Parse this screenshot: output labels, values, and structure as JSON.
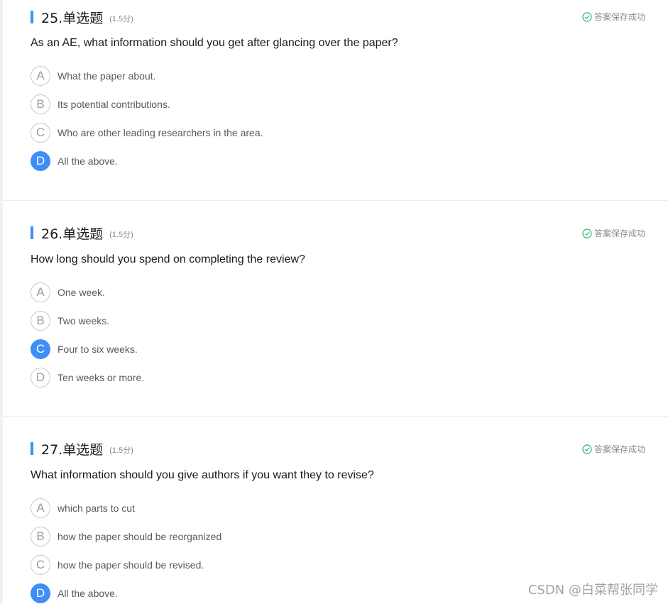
{
  "questions": [
    {
      "number_title": "25.单选题",
      "score": "(1.5分)",
      "status": "答案保存成功",
      "text": "As an AE, what information should you get after glancing over the paper?",
      "options": [
        {
          "letter": "A",
          "label": "What the paper about.",
          "selected": false
        },
        {
          "letter": "B",
          "label": "Its potential contributions.",
          "selected": false
        },
        {
          "letter": "C",
          "label": "Who are other leading researchers in the area.",
          "selected": false
        },
        {
          "letter": "D",
          "label": "All the above.",
          "selected": true
        }
      ]
    },
    {
      "number_title": "26.单选题",
      "score": "(1.5分)",
      "status": "答案保存成功",
      "text": "How long should you spend on completing the review?",
      "options": [
        {
          "letter": "A",
          "label": "One week.",
          "selected": false
        },
        {
          "letter": "B",
          "label": "Two weeks.",
          "selected": false
        },
        {
          "letter": "C",
          "label": "Four to six weeks.",
          "selected": true
        },
        {
          "letter": "D",
          "label": "Ten weeks or more.",
          "selected": false
        }
      ]
    },
    {
      "number_title": "27.单选题",
      "score": "(1.5分)",
      "status": "答案保存成功",
      "text": "What information should you give authors if you want they to revise?",
      "options": [
        {
          "letter": "A",
          "label": "which parts to cut",
          "selected": false
        },
        {
          "letter": "B",
          "label": "how the paper should be reorganized",
          "selected": false
        },
        {
          "letter": "C",
          "label": "how the paper should be revised.",
          "selected": false
        },
        {
          "letter": "D",
          "label": "All the above.",
          "selected": true
        }
      ]
    }
  ],
  "watermark": "CSDN @白菜帮张同学",
  "colors": {
    "accent": "#3f8ef7",
    "status_check": "#2fb36b"
  },
  "icons": {
    "status": "check-circle-icon"
  }
}
